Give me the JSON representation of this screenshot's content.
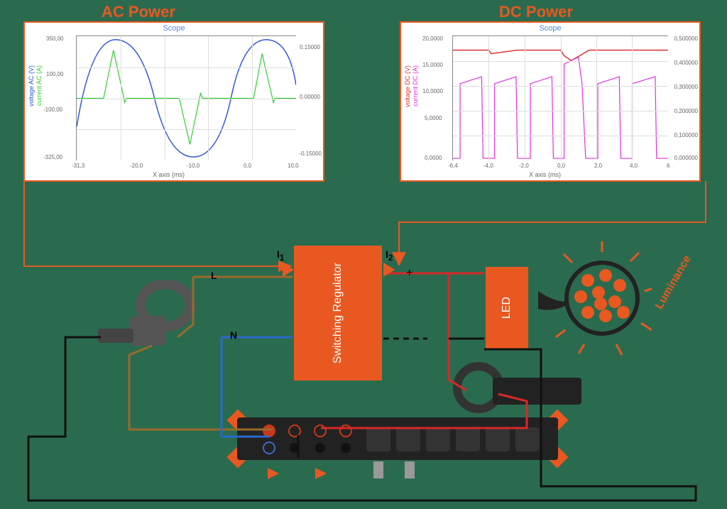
{
  "titles": {
    "ac": "AC Power",
    "dc": "DC Power"
  },
  "chart_data": [
    {
      "type": "line",
      "title": "Scope",
      "xlabel": "X axis (ms)",
      "ylabel_left": "voltage AC (V)",
      "ylabel_right": "current AC (A)",
      "x_ticks": [
        "-31,3",
        "-20,0",
        "-10,0",
        "0,0",
        "10,0"
      ],
      "y_ticks_left": [
        "-325,00",
        "-100,00",
        "100,00",
        "350,00"
      ],
      "y_ticks_right": [
        "-0.15000",
        "0.00000",
        "0.15000"
      ],
      "series": [
        {
          "name": "voltage AC",
          "color": "#3355dd"
        },
        {
          "name": "current AC",
          "color": "#33cc33"
        }
      ]
    },
    {
      "type": "line",
      "title": "Scope",
      "xlabel": "X axis (ms)",
      "ylabel_left": "voltage DC (V)",
      "ylabel_right": "current DC (A)",
      "x_ticks": [
        "-6,4",
        "-4,0",
        "-2,0",
        "0,0",
        "2,0",
        "4,0",
        "6"
      ],
      "y_ticks_left": [
        "0,0000",
        "5,0000",
        "10,0000",
        "15,0000",
        "20,0000"
      ],
      "y_ticks_right": [
        "0,000000",
        "0,100000",
        "0,200000",
        "0,300000",
        "0,400000",
        "0,500000"
      ],
      "series": [
        {
          "name": "voltage DC",
          "color": "#dd3333"
        },
        {
          "name": "current DC",
          "color": "#dd33dd"
        }
      ]
    }
  ],
  "labels": {
    "switching": "Switching Regulator",
    "led": "LED",
    "L": "L",
    "N": "N",
    "i1": "I",
    "i2": "I",
    "plus": "+",
    "luminance": "Luminance"
  }
}
